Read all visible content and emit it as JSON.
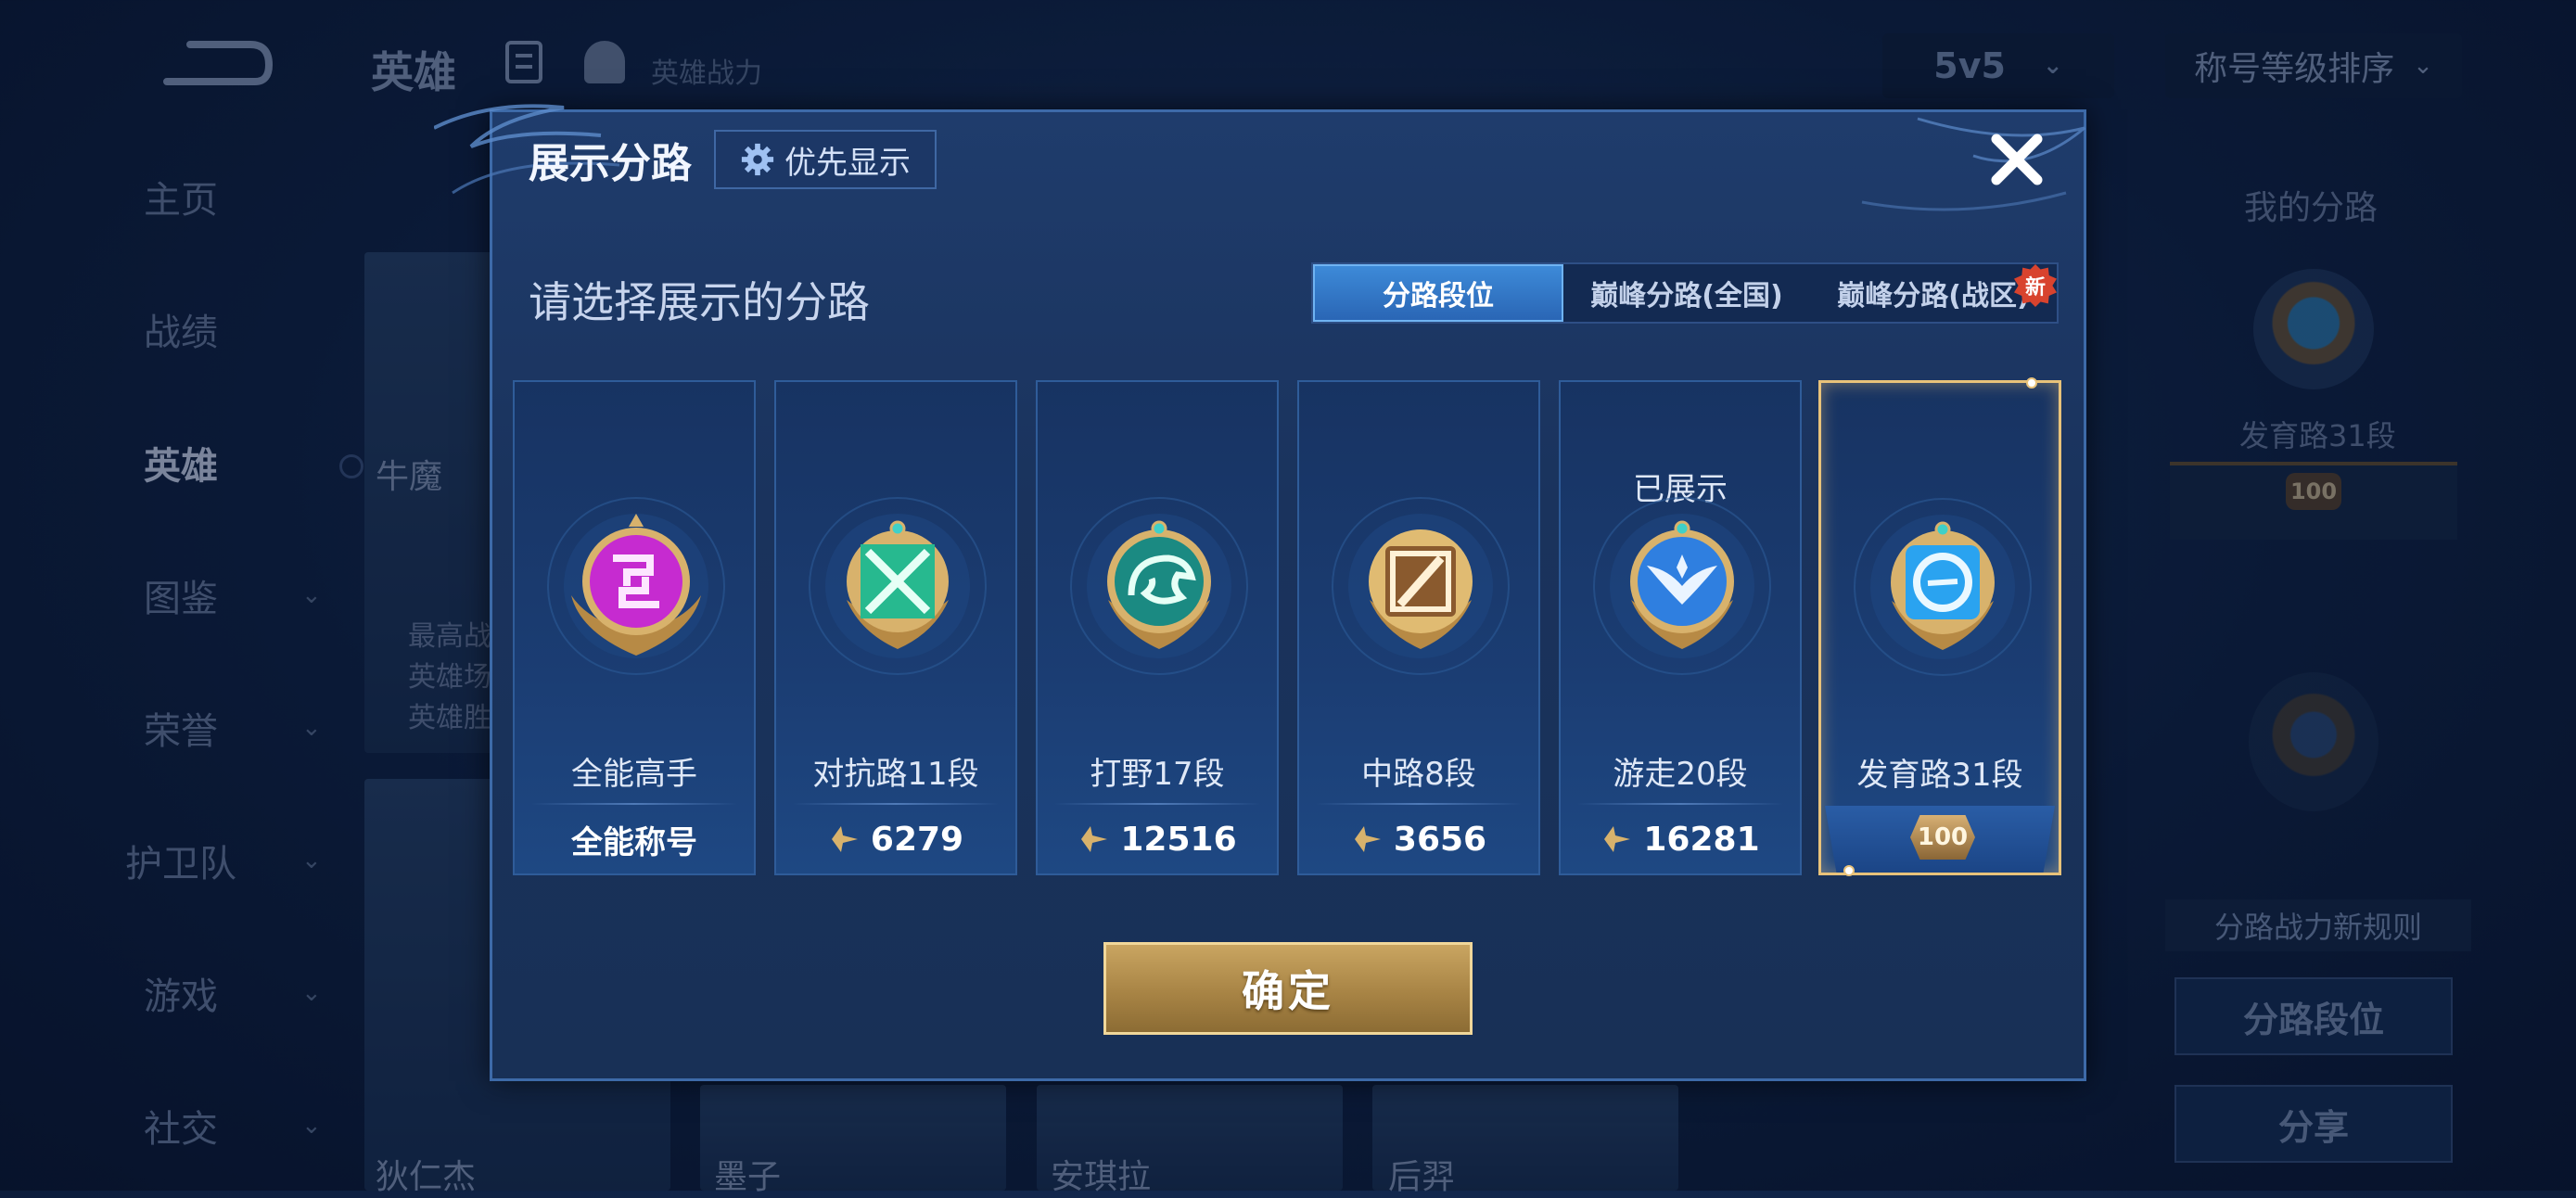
{
  "topbar": {
    "title": "英雄",
    "power_label": "英雄战力",
    "mode": "5v5",
    "sort": "称号等级排序"
  },
  "sidebar": {
    "items": [
      {
        "label": "主页"
      },
      {
        "label": "战绩"
      },
      {
        "label": "英雄"
      },
      {
        "label": "图鉴"
      },
      {
        "label": "荣誉"
      },
      {
        "label": "护卫队"
      },
      {
        "label": "游戏"
      },
      {
        "label": "社交"
      }
    ]
  },
  "background": {
    "hero_top": "牛魔",
    "hero_info_lines": [
      "最高战",
      "英雄场",
      "英雄胜"
    ],
    "heroes_bottom": [
      "狄仁杰",
      "墨子",
      "安琪拉",
      "后羿"
    ]
  },
  "right_panel": {
    "title": "我的分路",
    "lane": "发育路31段",
    "banner_num": "100",
    "rule": "分路战力新规则",
    "lane_button": "分路段位",
    "share_button": "分享"
  },
  "dialog": {
    "title": "展示分路",
    "priority_button": "优先显示",
    "prompt": "请选择展示的分路",
    "tabs": [
      {
        "label": "分路段位",
        "active": true
      },
      {
        "label": "巅峰分路(全国)",
        "active": false
      },
      {
        "label": "巅峰分路(战区)",
        "active": false
      }
    ],
    "new_badge": "新",
    "cards": [
      {
        "name": "全能高手",
        "footer": "全能称号"
      },
      {
        "name": "对抗路11段",
        "power": "6279"
      },
      {
        "name": "打野17段",
        "power": "12516"
      },
      {
        "name": "中路8段",
        "power": "3656"
      },
      {
        "name": "游走20段",
        "power": "16281",
        "status": "已展示"
      },
      {
        "name": "发育路31段",
        "banner_num": "100",
        "selected": true
      }
    ],
    "confirm_button": "确定"
  },
  "colors": {
    "accent_blue": "#2a66b5",
    "gold": "#e8c27a",
    "badge_purple": "#c62bd0",
    "badge_green": "#27b98f",
    "badge_teal": "#1b8a82",
    "badge_bronze": "#8a5a2e",
    "badge_blue": "#2f7fe0",
    "badge_skyblue": "#2aa3f0"
  }
}
